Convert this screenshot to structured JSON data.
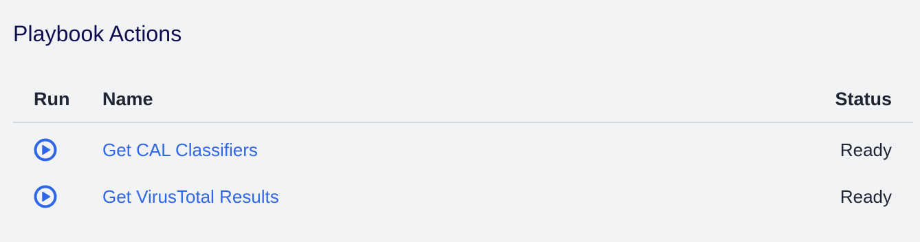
{
  "header": {
    "title": "Playbook Actions"
  },
  "table": {
    "columns": {
      "run": "Run",
      "name": "Name",
      "status": "Status"
    },
    "rows": [
      {
        "name": "Get CAL Classifiers",
        "status": "Ready",
        "run_icon": "play-circle-icon"
      },
      {
        "name": "Get VirusTotal Results",
        "status": "Ready",
        "run_icon": "play-circle-icon"
      }
    ]
  },
  "colors": {
    "accent": "#2f67e8",
    "title": "#0c0c4f",
    "text": "#1f2633",
    "background": "#f2f3f5",
    "divider": "#d3d6db"
  }
}
